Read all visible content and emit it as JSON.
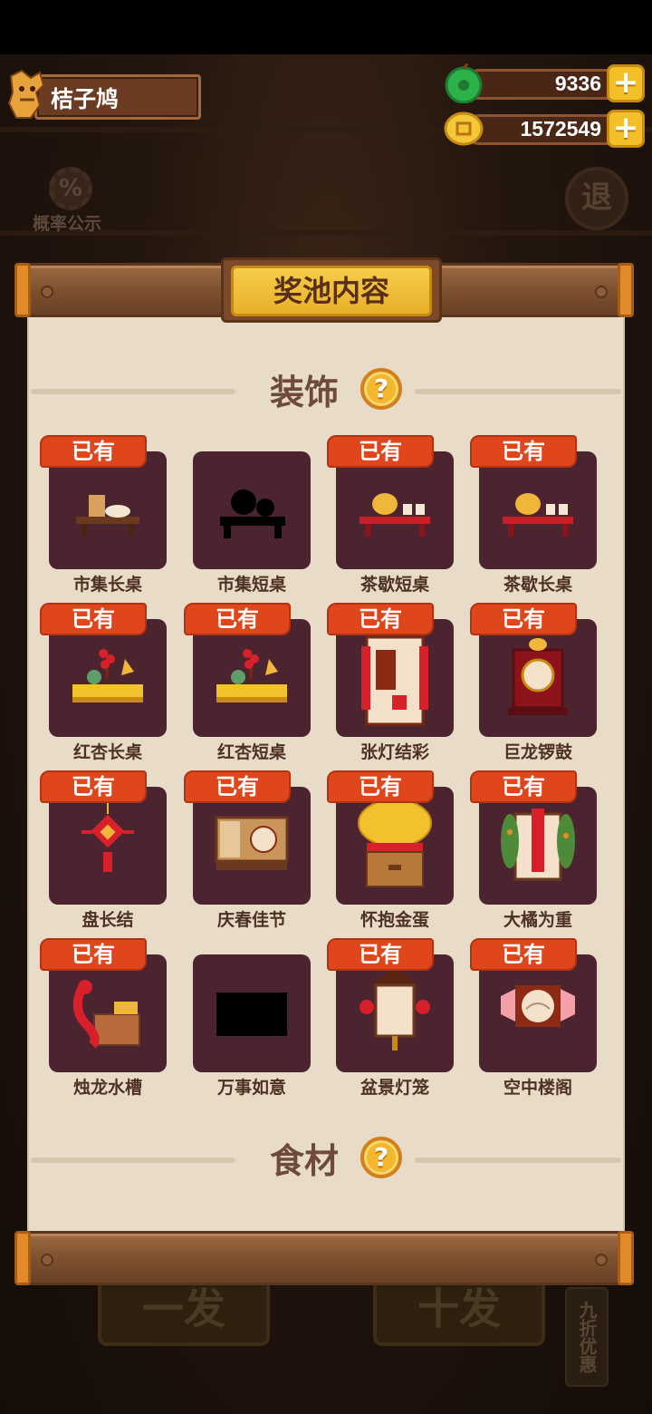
{
  "player": {
    "name": "桔子鸠"
  },
  "currency": {
    "jade": {
      "value": "9336",
      "plus": "+"
    },
    "coin": {
      "value": "1572549",
      "plus": "+"
    }
  },
  "probability": {
    "label": "概率公示",
    "icon_text": "%"
  },
  "exit": {
    "label": "退"
  },
  "background": {
    "single_draw": "一发",
    "ten_draw": "十发",
    "discount": "九折优惠"
  },
  "panel": {
    "title": "奖池内容",
    "sections": [
      {
        "title": "装饰",
        "help": "?"
      },
      {
        "title": "食材",
        "help": "?"
      }
    ],
    "owned_label": "已有",
    "items": [
      {
        "name": "市集长桌",
        "owned": true,
        "icon": "market-long-table-icon"
      },
      {
        "name": "市集短桌",
        "owned": false,
        "icon": "market-short-table-silhouette-icon"
      },
      {
        "name": "茶歇短桌",
        "owned": true,
        "icon": "tea-short-table-icon"
      },
      {
        "name": "茶歇长桌",
        "owned": true,
        "icon": "tea-long-table-icon"
      },
      {
        "name": "红杏长桌",
        "owned": true,
        "icon": "apricot-long-table-icon"
      },
      {
        "name": "红杏短桌",
        "owned": true,
        "icon": "apricot-short-table-icon"
      },
      {
        "name": "张灯结彩",
        "owned": true,
        "icon": "lantern-decoration-icon"
      },
      {
        "name": "巨龙锣鼓",
        "owned": true,
        "icon": "dragon-gong-icon"
      },
      {
        "name": "盘长结",
        "owned": true,
        "icon": "chinese-knot-icon"
      },
      {
        "name": "庆春佳节",
        "owned": true,
        "icon": "spring-festival-icon"
      },
      {
        "name": "怀抱金蛋",
        "owned": true,
        "icon": "golden-egg-icon"
      },
      {
        "name": "大橘为重",
        "owned": true,
        "icon": "orange-tree-icon"
      },
      {
        "name": "烛龙水槽",
        "owned": true,
        "icon": "dragon-sink-icon"
      },
      {
        "name": "万事如意",
        "owned": false,
        "icon": "ruyi-silhouette-icon"
      },
      {
        "name": "盆景灯笼",
        "owned": true,
        "icon": "bonsai-lantern-icon"
      },
      {
        "name": "空中楼阁",
        "owned": true,
        "icon": "sky-pavilion-icon"
      }
    ]
  },
  "colors": {
    "accent_gold": "#f4c02a",
    "owned_badge": "#e0461c",
    "card_bg": "#4b2430",
    "paper": "#e8dcc9"
  }
}
